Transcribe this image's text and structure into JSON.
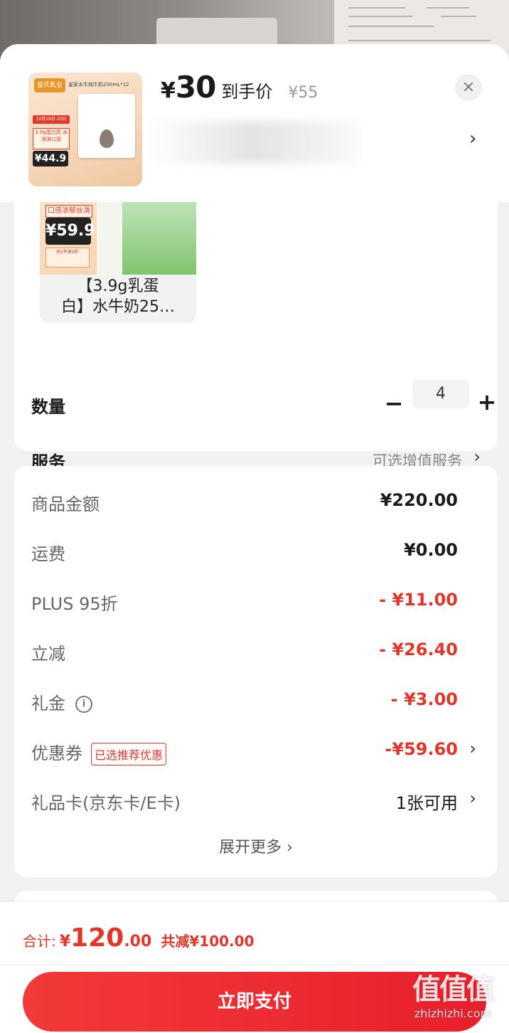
{
  "header": {
    "price_symbol": "¥",
    "price": "30",
    "price_label": "到手价",
    "original_price": "¥55",
    "close_glyph": "×",
    "chevron": "›",
    "thumb": {
      "brand": "皇氏乳业",
      "title": "皇家水牛纯牛奶200mL*12",
      "tag1": "12月19日-20日",
      "tag2": "3.9g蛋白质 冰淇淋口感",
      "price": "¥44.9"
    }
  },
  "variant": {
    "tag": "口感浓郁丝滑",
    "price": "¥59.9",
    "promo": "抢2件享9折",
    "name_line1": "【3.9g乳蛋",
    "name_line2": "白】水牛奶25…"
  },
  "quantity": {
    "label": "数量",
    "minus": "−",
    "value": "4",
    "plus": "+"
  },
  "service": {
    "label": "服务",
    "value": "可选增值服务",
    "chevron": "›"
  },
  "summary": {
    "rows": [
      {
        "label": "商品金额",
        "value": "¥220.00"
      },
      {
        "label": "运费",
        "value": "¥0.00"
      },
      {
        "label": "PLUS 95折",
        "value": "- ¥11.00"
      },
      {
        "label": "立减",
        "value": "- ¥26.40"
      },
      {
        "label": "礼金",
        "value": "- ¥3.00",
        "info": "i"
      },
      {
        "label": "优惠券",
        "value": "-¥59.60",
        "tag": "已选推荐优惠",
        "chevron": "›"
      },
      {
        "label": "礼品卡(京东卡/E卡)",
        "value": "1张可用",
        "chevron": "›"
      }
    ],
    "expand": "展开更多 ›"
  },
  "footer": {
    "total_label": "合计:",
    "total_symbol": "¥",
    "total_int": "120",
    "total_dec": ".00",
    "saved": "共减¥100.00",
    "pay_button": "立即支付"
  },
  "watermark": {
    "logo": "值值值",
    "site": "zhizhizhi.com"
  },
  "colors": {
    "accent_red": "#e2362b",
    "button_red": "#f23a3a"
  }
}
